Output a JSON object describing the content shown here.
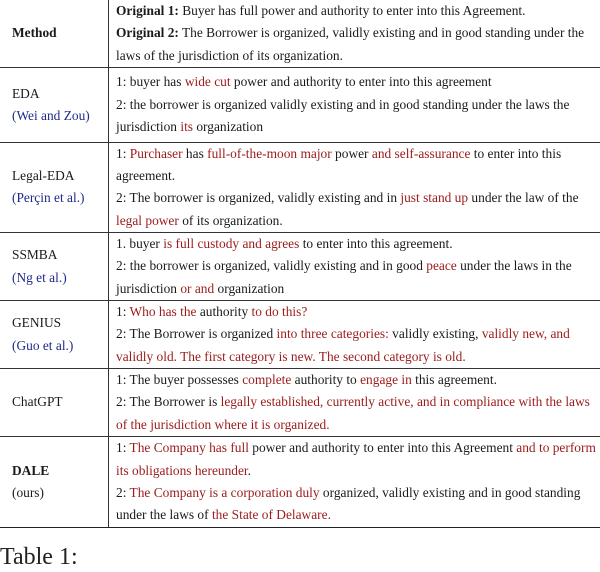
{
  "table": {
    "header": {
      "method_label": "Method",
      "original_1_label": "Original 1:",
      "original_1_text": " Buyer has full power and authority to enter into this Agreement.",
      "original_2_label": "Original 2:",
      "original_2_text": " The Borrower is organized, validly existing and in good standing under the laws of the jurisdiction of its organization."
    },
    "rows": [
      {
        "method": "EDA",
        "citation": "(Wei and Zou)",
        "lines": [
          [
            {
              "t": "1: buyer has ",
              "hl": false
            },
            {
              "t": "wide cut",
              "hl": true
            },
            {
              "t": " power and authority to enter into this agreement",
              "hl": false
            }
          ],
          [
            {
              "t": "2: the borrower is organized validly existing and in good standing under the laws the jurisdiction ",
              "hl": false
            },
            {
              "t": "its",
              "hl": true
            },
            {
              "t": " organization",
              "hl": false
            }
          ]
        ]
      },
      {
        "method": "Legal-EDA",
        "citation": "(Perçin et al.)",
        "lines": [
          [
            {
              "t": "1: ",
              "hl": false
            },
            {
              "t": "Purchaser",
              "hl": true
            },
            {
              "t": " has ",
              "hl": false
            },
            {
              "t": "full-of-the-moon major",
              "hl": true
            },
            {
              "t": " power ",
              "hl": false
            },
            {
              "t": "and self-assurance",
              "hl": true
            },
            {
              "t": " to enter into this agreement.",
              "hl": false
            }
          ],
          [
            {
              "t": "2: The borrower is organized, validly existing and in ",
              "hl": false
            },
            {
              "t": "just stand up",
              "hl": true
            },
            {
              "t": " under the law of the ",
              "hl": false
            },
            {
              "t": "legal power",
              "hl": true
            },
            {
              "t": " of its organization.",
              "hl": false
            }
          ]
        ]
      },
      {
        "method": "SSMBA",
        "citation": "(Ng et al.)",
        "lines": [
          [
            {
              "t": "1. buyer ",
              "hl": false
            },
            {
              "t": "is full custody and agrees",
              "hl": true
            },
            {
              "t": " to enter into this agreement.",
              "hl": false
            }
          ],
          [
            {
              "t": "2: the borrower is organized, validly existing and in good ",
              "hl": false
            },
            {
              "t": "peace",
              "hl": true
            },
            {
              "t": " under the laws in the jurisdiction ",
              "hl": false
            },
            {
              "t": "or and",
              "hl": true
            },
            {
              "t": " organization",
              "hl": false
            }
          ]
        ]
      },
      {
        "method": "GENIUS",
        "citation": "(Guo et al.)",
        "lines": [
          [
            {
              "t": "1: ",
              "hl": false
            },
            {
              "t": "Who has the",
              "hl": true
            },
            {
              "t": " authority ",
              "hl": false
            },
            {
              "t": "to do this?",
              "hl": true
            }
          ],
          [
            {
              "t": "2: The Borrower is organized ",
              "hl": false
            },
            {
              "t": "into three categories:",
              "hl": true
            },
            {
              "t": " validly existing, ",
              "hl": false
            },
            {
              "t": "validly new, and validly old. The first category is new. The second category is old.",
              "hl": true
            }
          ]
        ]
      },
      {
        "method": "ChatGPT",
        "citation": "",
        "lines": [
          [
            {
              "t": "1: The buyer possesses ",
              "hl": false
            },
            {
              "t": "complete",
              "hl": true
            },
            {
              "t": " authority to ",
              "hl": false
            },
            {
              "t": "engage in",
              "hl": true
            },
            {
              "t": " this agreement.",
              "hl": false
            }
          ],
          [
            {
              "t": "2: The Borrower is ",
              "hl": false
            },
            {
              "t": "legally established, currently active, and in compliance with the laws of the jurisdiction where it is organized.",
              "hl": true
            }
          ]
        ]
      },
      {
        "method": "DALE",
        "method_bold": true,
        "citation": "(ours)",
        "lines": [
          [
            {
              "t": "1: ",
              "hl": false
            },
            {
              "t": "The Company has full",
              "hl": true
            },
            {
              "t": " power and authority to enter into this Agreement ",
              "hl": false
            },
            {
              "t": "and to perform its obligations hereunder",
              "hl": true
            },
            {
              "t": ".",
              "hl": false
            }
          ],
          [
            {
              "t": "2: ",
              "hl": false
            },
            {
              "t": "The Company is a corporation duly",
              "hl": true
            },
            {
              "t": " organized, validly existing and in good standing under the laws of ",
              "hl": false
            },
            {
              "t": "the State of Delaware.",
              "hl": true
            }
          ]
        ]
      }
    ]
  },
  "caption": "Table 1:",
  "colors": {
    "highlight": "#9b1b1b",
    "citation": "#1f2a8a",
    "text": "#1a1a1a"
  }
}
